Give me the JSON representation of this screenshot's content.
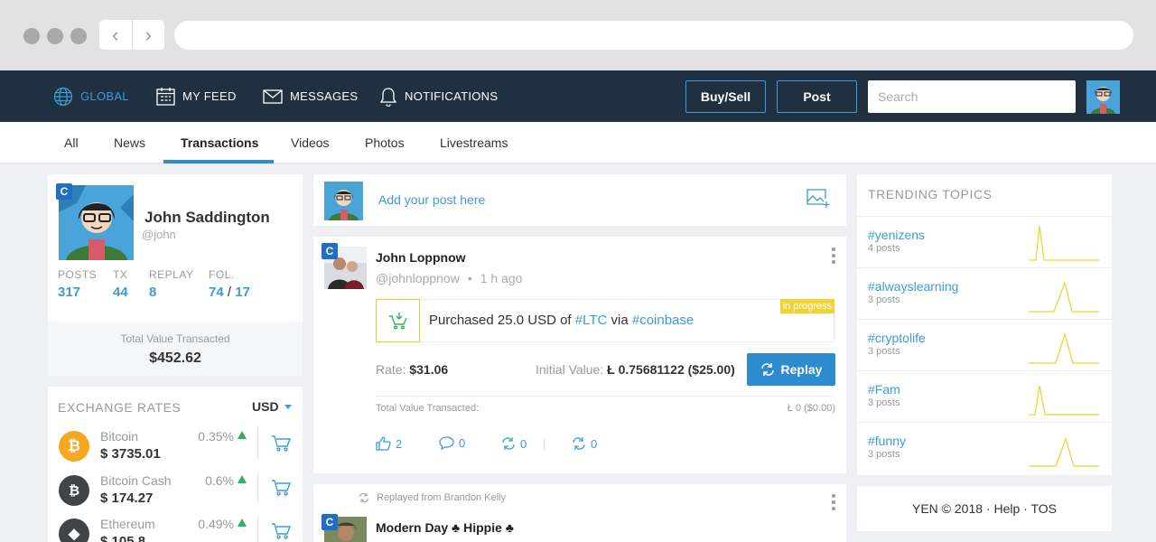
{
  "header": {
    "nav": [
      {
        "label": "GLOBAL",
        "icon": "globe-icon",
        "active": true
      },
      {
        "label": "MY FEED",
        "icon": "calendar-icon"
      },
      {
        "label": "MESSAGES",
        "icon": "envelope-icon"
      },
      {
        "label": "NOTIFICATIONS",
        "icon": "bell-icon"
      }
    ],
    "buy_sell_label": "Buy/Sell",
    "post_label": "Post",
    "search_placeholder": "Search"
  },
  "tabs": [
    {
      "label": "All"
    },
    {
      "label": "News"
    },
    {
      "label": "Transactions",
      "active": true
    },
    {
      "label": "Videos"
    },
    {
      "label": "Photos"
    },
    {
      "label": "Livestreams"
    }
  ],
  "profile": {
    "badge": "C",
    "name": "John Saddington",
    "handle": "@john",
    "stats": {
      "posts_label": "POSTS",
      "posts": "317",
      "tx_label": "TX",
      "tx": "44",
      "replay_label": "REPLAY",
      "replay": "8",
      "fol_label": "FOL.",
      "followers": "74",
      "sep": "/",
      "following": "17"
    },
    "total_label": "Total Value Transacted",
    "total_value": "$452.62"
  },
  "exchange": {
    "title": "EXCHANGE RATES",
    "currency": "USD",
    "coins": [
      {
        "name": "Bitcoin",
        "price": "$ 3735.01",
        "change": "0.35%",
        "color": "#f7a823",
        "symbol": "₿"
      },
      {
        "name": "Bitcoin Cash",
        "price": "$ 174.27",
        "change": "0.6%",
        "color": "#404447",
        "symbol": "₿"
      },
      {
        "name": "Ethereum",
        "price": "$ 105.8",
        "change": "0.49%",
        "color": "#404447",
        "symbol": "◆"
      }
    ]
  },
  "composer": {
    "placeholder": "Add your post here"
  },
  "post1": {
    "badge": "C",
    "author": "John Loppnow",
    "handle": "@johnloppnow",
    "bullet": "•",
    "time": "1 h ago",
    "status": "in progress",
    "tx_prefix": "Purchased 25.0 USD of ",
    "tx_coin": "#LTC",
    "tx_mid": " via ",
    "tx_exchange": "#coinbase",
    "rate_label": "Rate:",
    "rate_value": "$31.06",
    "initial_label": "Initial Value:",
    "initial_value": "Ł 0.75681122 ($25.00)",
    "replay_label": "Replay",
    "total_label": "Total Value Transacted:",
    "total_value": "Ł 0 ($0.00)",
    "likes": "2",
    "comments": "0",
    "reposts": "0",
    "replays": "0",
    "divider": "|"
  },
  "post2": {
    "badge": "C",
    "replayed_from": "Replayed from Brandon Kelly",
    "author": "Modern Day ♣ Hippie ♣"
  },
  "trending": {
    "title": "TRENDING TOPICS",
    "topics": [
      {
        "tag": "#yenizens",
        "count": "4 posts"
      },
      {
        "tag": "#alwayslearning",
        "count": "3 posts"
      },
      {
        "tag": "#cryptolife",
        "count": "3 posts"
      },
      {
        "tag": "#Fam",
        "count": "3 posts"
      },
      {
        "tag": "#funny",
        "count": "3 posts"
      }
    ],
    "spark_color": "#f2d335"
  },
  "footer": {
    "text": "YEN © 2018 · Help · TOS"
  }
}
